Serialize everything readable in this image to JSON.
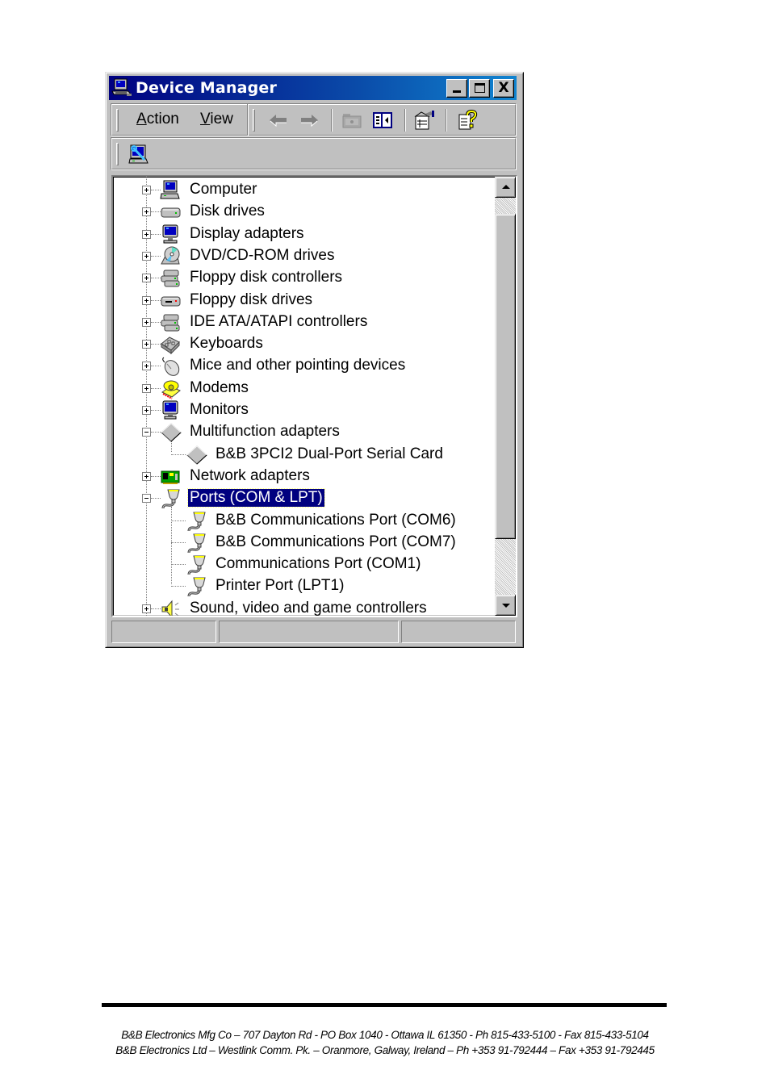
{
  "window": {
    "title": "Device Manager",
    "title_icon": "computer-management-icon",
    "controls": {
      "minimize": "minimize",
      "maximize": "maximize",
      "close": "X"
    }
  },
  "menu": [
    {
      "label": "Action",
      "accel": "A",
      "rest": "ction"
    },
    {
      "label": "View",
      "accel": "V",
      "rest": "iew"
    }
  ],
  "toolbar": {
    "buttons": [
      {
        "name": "back",
        "icon": "arrow-left-icon",
        "enabled": false
      },
      {
        "name": "forward",
        "icon": "arrow-right-icon",
        "enabled": false
      },
      {
        "name": "up-folder",
        "icon": "folder-icon",
        "enabled": false
      },
      {
        "name": "show-hide-console-tree",
        "icon": "console-tree-icon",
        "enabled": true
      },
      {
        "name": "properties",
        "icon": "properties-icon",
        "enabled": true
      },
      {
        "name": "help",
        "icon": "help-icon",
        "enabled": true
      }
    ],
    "row2": [
      {
        "name": "scan-for-hardware-changes",
        "icon": "scan-hardware-icon"
      }
    ]
  },
  "tree": {
    "items": [
      {
        "label": "Computer",
        "icon": "computer-icon",
        "level": 1,
        "state": "collapsed"
      },
      {
        "label": "Disk drives",
        "icon": "disk-drive-icon",
        "level": 1,
        "state": "collapsed"
      },
      {
        "label": "Display adapters",
        "icon": "display-adapter-icon",
        "level": 1,
        "state": "collapsed"
      },
      {
        "label": "DVD/CD-ROM drives",
        "icon": "cdrom-icon",
        "level": 1,
        "state": "collapsed"
      },
      {
        "label": "Floppy disk controllers",
        "icon": "controller-icon",
        "level": 1,
        "state": "collapsed"
      },
      {
        "label": "Floppy disk drives",
        "icon": "floppy-drive-icon",
        "level": 1,
        "state": "collapsed"
      },
      {
        "label": "IDE ATA/ATAPI controllers",
        "icon": "controller-icon",
        "level": 1,
        "state": "collapsed"
      },
      {
        "label": "Keyboards",
        "icon": "keyboard-icon",
        "level": 1,
        "state": "collapsed"
      },
      {
        "label": "Mice and other pointing devices",
        "icon": "mouse-icon",
        "level": 1,
        "state": "collapsed"
      },
      {
        "label": "Modems",
        "icon": "modem-icon",
        "level": 1,
        "state": "collapsed"
      },
      {
        "label": "Monitors",
        "icon": "monitor-icon",
        "level": 1,
        "state": "collapsed"
      },
      {
        "label": "Multifunction adapters",
        "icon": "multifunction-icon",
        "level": 1,
        "state": "expanded"
      },
      {
        "label": "B&B 3PCI2 Dual-Port Serial Card",
        "icon": "multifunction-icon",
        "level": 2,
        "state": "leaf"
      },
      {
        "label": "Network adapters",
        "icon": "network-adapter-icon",
        "level": 1,
        "state": "collapsed"
      },
      {
        "label": "Ports (COM & LPT)",
        "icon": "port-icon",
        "level": 1,
        "state": "expanded",
        "selected": true
      },
      {
        "label": "B&B Communications Port (COM6)",
        "icon": "port-icon",
        "level": 2,
        "state": "leaf"
      },
      {
        "label": "B&B Communications Port (COM7)",
        "icon": "port-icon",
        "level": 2,
        "state": "leaf"
      },
      {
        "label": "Communications Port (COM1)",
        "icon": "port-icon",
        "level": 2,
        "state": "leaf"
      },
      {
        "label": "Printer Port (LPT1)",
        "icon": "port-icon",
        "level": 2,
        "state": "leaf"
      },
      {
        "label": "Sound, video and game controllers",
        "icon": "sound-icon",
        "level": 1,
        "state": "collapsed"
      }
    ],
    "scroll": {
      "thumb_start_fraction": 0.04,
      "thumb_size_fraction": 0.82
    }
  },
  "statusbar": {
    "panels": [
      "",
      "",
      ""
    ]
  },
  "footer": {
    "line1": "B&B Electronics Mfg Co – 707 Dayton Rd - PO Box 1040 - Ottawa IL 61350 - Ph 815-433-5100 - Fax 815-433-5104",
    "line2": "B&B Electronics Ltd – Westlink Comm. Pk. – Oranmore, Galway, Ireland – Ph +353 91-792444 – Fax +353 91-792445"
  },
  "colors": {
    "titlebar_start": "#000080",
    "titlebar_end": "#1084d0",
    "selection": "#000080",
    "face": "#c0c0c0"
  }
}
